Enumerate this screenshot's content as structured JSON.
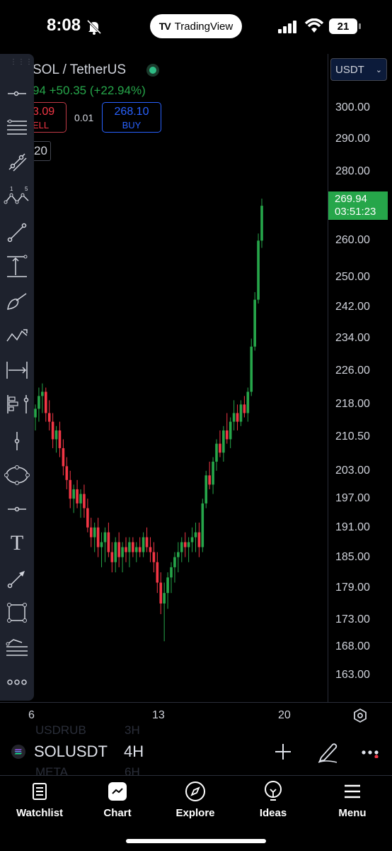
{
  "status_bar": {
    "time": "8:08",
    "app_pill": "TradingView",
    "battery": "21"
  },
  "legend": {
    "symbol_title": "SOL / TetherUS",
    "change_line": "94  +50.35 (+22.94%)",
    "sell_price": "3.09",
    "sell_label": "ELL",
    "spread": "0.01",
    "buy_price": "268.10",
    "buy_label": "BUY",
    "quantity": "20"
  },
  "price_axis": {
    "currency": "USDT",
    "ticks": [
      "300.00",
      "290.00",
      "280.00",
      "260.00",
      "250.00",
      "242.00",
      "234.00",
      "226.00",
      "218.00",
      "210.50",
      "203.00",
      "197.00",
      "191.00",
      "185.00",
      "179.00",
      "173.00",
      "168.00",
      "163.00"
    ],
    "last_price": "269.94",
    "countdown": "03:51:23",
    "last_price_color": "#26a64a"
  },
  "time_axis": {
    "ticks": [
      "6",
      "13",
      "20"
    ]
  },
  "colors": {
    "up": "#26a64a",
    "down": "#f23645",
    "background": "#000000"
  },
  "symbol_bar": {
    "symbol": "SOLUSDT",
    "interval": "4H",
    "ghost_rows": [
      {
        "symbol": "USDRUB",
        "interval": "3H"
      },
      {
        "symbol": "META",
        "interval": "6H"
      }
    ]
  },
  "toolbar": {
    "icons": [
      "horizontal-line-icon",
      "multi-line-icon",
      "trend-line-icon",
      "pattern-icon",
      "ray-icon",
      "price-range-icon",
      "brush-icon",
      "path-icon",
      "date-range-icon",
      "forecast-icon",
      "vertical-line-icon",
      "ellipse-icon",
      "cross-line-icon",
      "text-icon",
      "arrow-icon",
      "rectangle-icon",
      "fib-icon",
      "more-tools-icon"
    ],
    "pattern_labels": [
      "1",
      "5"
    ],
    "text_glyph": "T"
  },
  "tabs": [
    {
      "label": "Watchlist",
      "icon": "watchlist-icon"
    },
    {
      "label": "Chart",
      "icon": "chart-icon"
    },
    {
      "label": "Explore",
      "icon": "compass-icon"
    },
    {
      "label": "Ideas",
      "icon": "bulb-icon"
    },
    {
      "label": "Menu",
      "icon": "menu-icon"
    }
  ],
  "chart_data": {
    "type": "candlestick",
    "x": [
      "6",
      "13",
      "20"
    ],
    "ylim": [
      160,
      305
    ],
    "candles": [
      [
        215,
        218,
        212,
        217
      ],
      [
        217,
        222,
        214,
        220
      ],
      [
        220,
        223,
        216,
        221
      ],
      [
        221,
        222,
        214,
        216
      ],
      [
        216,
        219,
        212,
        214
      ],
      [
        214,
        216,
        208,
        210
      ],
      [
        210,
        213,
        207,
        212
      ],
      [
        212,
        214,
        206,
        208
      ],
      [
        208,
        210,
        202,
        204
      ],
      [
        204,
        206,
        199,
        201
      ],
      [
        201,
        203,
        195,
        197
      ],
      [
        197,
        200,
        194,
        199
      ],
      [
        199,
        201,
        195,
        196
      ],
      [
        196,
        199,
        193,
        198
      ],
      [
        198,
        200,
        193,
        195
      ],
      [
        195,
        197,
        190,
        191
      ],
      [
        191,
        193,
        187,
        189
      ],
      [
        189,
        192,
        186,
        191
      ],
      [
        191,
        193,
        185,
        187
      ],
      [
        187,
        190,
        183,
        188
      ],
      [
        188,
        191,
        184,
        190
      ],
      [
        190,
        192,
        185,
        186
      ],
      [
        186,
        188,
        182,
        184
      ],
      [
        184,
        189,
        182,
        188
      ],
      [
        188,
        190,
        183,
        185
      ],
      [
        185,
        188,
        182,
        187
      ],
      [
        187,
        189,
        184,
        186
      ],
      [
        186,
        189,
        183,
        188
      ],
      [
        188,
        189,
        185,
        186
      ],
      [
        186,
        188,
        184,
        187
      ],
      [
        187,
        189,
        185,
        186
      ],
      [
        186,
        190,
        185,
        189
      ],
      [
        189,
        191,
        186,
        187
      ],
      [
        187,
        189,
        184,
        186
      ],
      [
        186,
        188,
        182,
        184
      ],
      [
        184,
        186,
        178,
        180
      ],
      [
        180,
        182,
        174,
        176
      ],
      [
        176,
        180,
        169,
        178
      ],
      [
        178,
        182,
        175,
        181
      ],
      [
        181,
        184,
        178,
        183
      ],
      [
        183,
        186,
        180,
        185
      ],
      [
        185,
        188,
        182,
        186
      ],
      [
        186,
        189,
        184,
        188
      ],
      [
        188,
        190,
        185,
        187
      ],
      [
        187,
        189,
        184,
        188
      ],
      [
        188,
        191,
        186,
        189
      ],
      [
        189,
        192,
        186,
        190
      ],
      [
        190,
        192,
        185,
        187
      ],
      [
        187,
        197,
        186,
        196
      ],
      [
        196,
        203,
        195,
        202
      ],
      [
        202,
        205,
        199,
        200
      ],
      [
        200,
        206,
        198,
        205
      ],
      [
        205,
        210,
        203,
        209
      ],
      [
        209,
        212,
        206,
        207
      ],
      [
        207,
        213,
        205,
        212
      ],
      [
        212,
        216,
        209,
        210
      ],
      [
        210,
        215,
        208,
        214
      ],
      [
        214,
        219,
        212,
        216
      ],
      [
        216,
        218,
        212,
        214
      ],
      [
        214,
        219,
        213,
        218
      ],
      [
        218,
        220,
        215,
        216
      ],
      [
        216,
        222,
        214,
        221
      ],
      [
        221,
        234,
        220,
        232
      ],
      [
        232,
        246,
        231,
        244
      ],
      [
        244,
        262,
        243,
        260
      ],
      [
        260,
        272,
        258,
        269.94
      ]
    ]
  }
}
